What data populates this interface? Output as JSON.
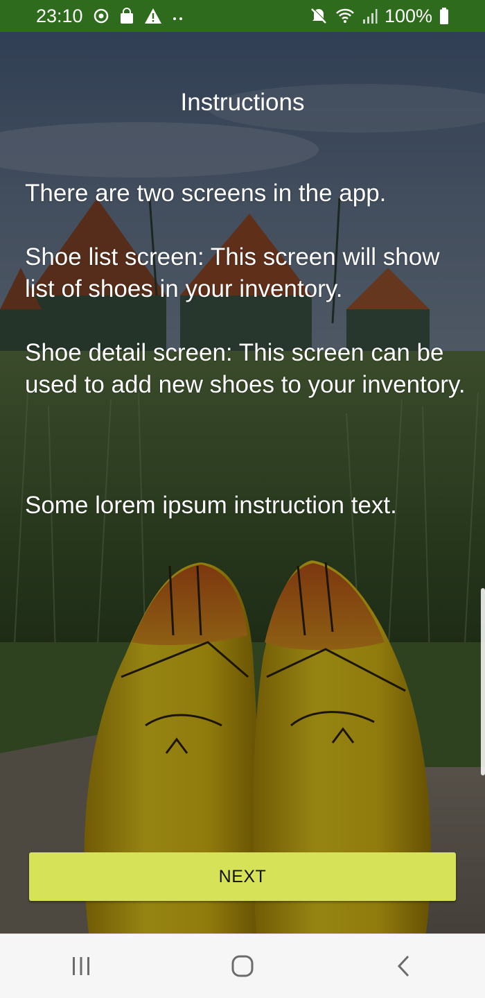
{
  "status_bar": {
    "time": "23:10",
    "battery": "100%",
    "left_icons": [
      "sync-icon",
      "shopping-bag-icon",
      "warning-icon",
      "more-dots-icon"
    ],
    "right_icons": [
      "mute-icon",
      "wifi-icon",
      "signal-icon",
      "battery-icon"
    ]
  },
  "screen": {
    "title": "Instructions",
    "paragraphs": [
      "There are two screens in the app.",
      " Shoe list screen: This screen will show list of shoes in your inventory.",
      " Shoe detail screen: This screen can be used to add new shoes to your inventory.",
      "Some lorem ipsum instruction text."
    ],
    "next_button": "NEXT"
  },
  "nav_bar": {
    "icons": [
      "recents-icon",
      "home-icon",
      "back-icon"
    ]
  },
  "colors": {
    "status_bar": "#2f6b1d",
    "button": "#d6e257",
    "nav_bar": "#f6f6f6"
  }
}
